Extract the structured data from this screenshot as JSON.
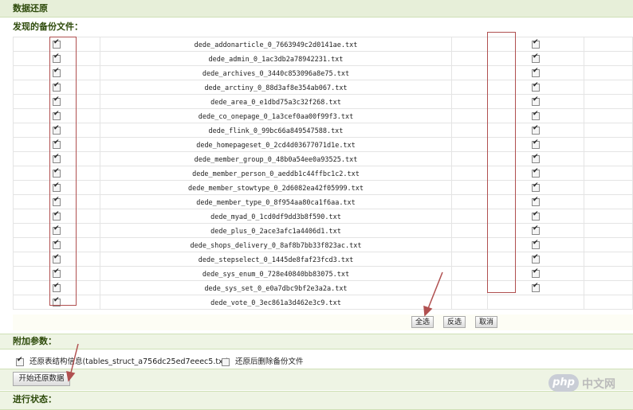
{
  "header": {
    "title": "数据还原"
  },
  "backup_section": {
    "title": "发现的备份文件："
  },
  "files": [
    "dede_addonarticle_0_7663949c2d0141ae.txt",
    "dede_admin_0_1ac3db2a78942231.txt",
    "dede_archives_0_3440c853096a8e75.txt",
    "dede_arctiny_0_88d3af8e354ab067.txt",
    "dede_area_0_e1dbd75a3c32f268.txt",
    "dede_co_onepage_0_1a3cef0aa00f99f3.txt",
    "dede_flink_0_99bc66a849547588.txt",
    "dede_homepageset_0_2cd4d03677071d1e.txt",
    "dede_member_group_0_48b0a54ee0a93525.txt",
    "dede_member_person_0_aeddb1c44ffbc1c2.txt",
    "dede_member_stowtype_0_2d6082ea42f05999.txt",
    "dede_member_type_0_8f954aa80ca1f6aa.txt",
    "dede_myad_0_1cd0df9dd3b8f590.txt",
    "dede_plus_0_2ace3afc1a4406d1.txt",
    "dede_shops_delivery_0_8af8b7bb33f823ac.txt",
    "dede_stepselect_0_1445de8faf23fcd3.txt",
    "dede_sys_enum_0_728e40840bb83075.txt",
    "dede_sys_set_0_e0a7dbc9bf2e3a2a.txt",
    "dede_vote_0_3ec861a3d462e3c9.txt"
  ],
  "checkmark_glyph": "✔",
  "buttons": {
    "select_all": "全选",
    "invert": "反选",
    "cancel": "取消"
  },
  "extra_section": {
    "title": "附加参数："
  },
  "options": {
    "restore_structure": {
      "label": "还原表结构信息(tables_struct_a756dc25ed7eeec5.txt)",
      "checked": true
    },
    "delete_backup": {
      "label": "还原后删除备份文件",
      "checked": false
    }
  },
  "start_button": {
    "label": "开始还原数据"
  },
  "status_section": {
    "title": "进行状态："
  },
  "watermark": {
    "logo": "php",
    "text": "中文网"
  },
  "colors": {
    "accent_bar": "#eef4e4",
    "title_text": "#2d4a0a",
    "annotation_red": "#b05050"
  }
}
